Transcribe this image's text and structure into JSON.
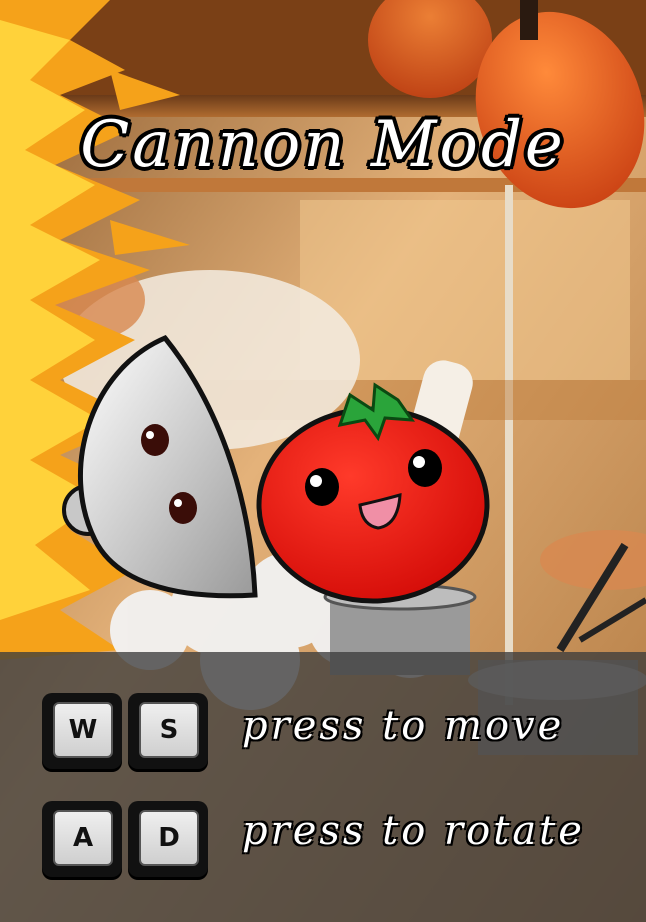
{
  "title": "Cannon Mode",
  "controls": [
    {
      "keys": [
        "W",
        "S"
      ],
      "label": "press to move"
    },
    {
      "keys": [
        "A",
        "D"
      ],
      "label": "press to rotate"
    }
  ],
  "characters": [
    "knife-character",
    "tomato-character"
  ],
  "colors": {
    "tomato": "#e8140e",
    "panel": "#3c3c3c",
    "fire": "#f5a21a",
    "wall": "#d8a060"
  }
}
